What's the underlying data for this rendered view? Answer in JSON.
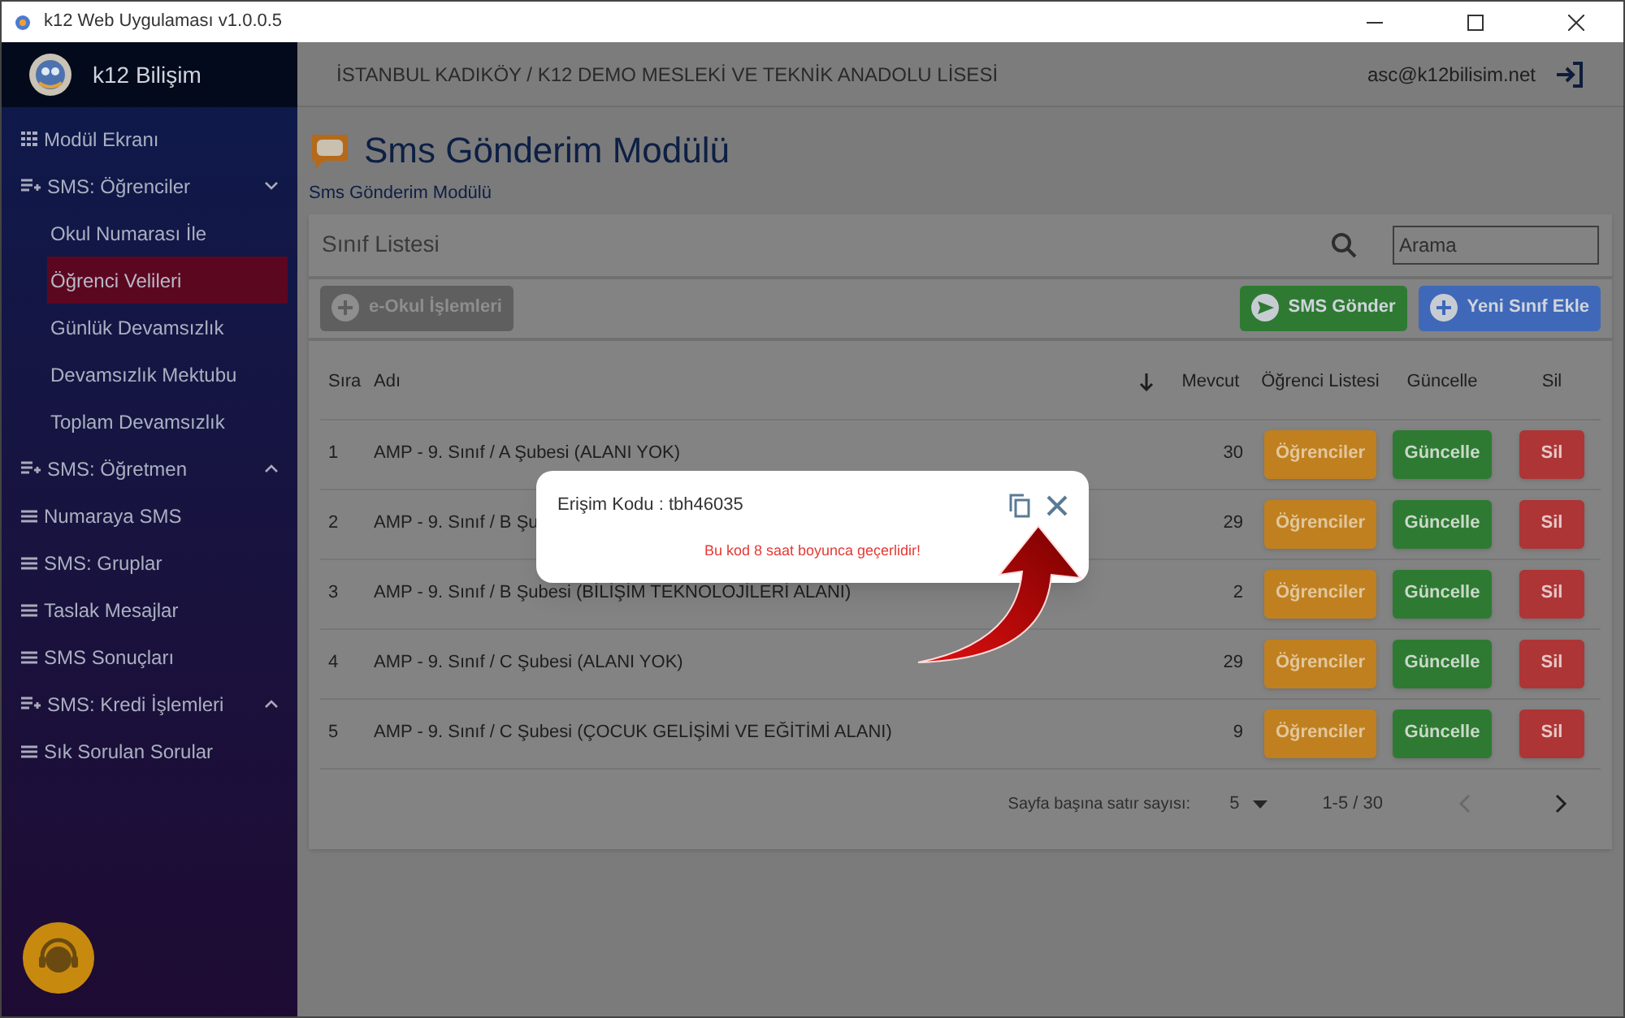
{
  "window": {
    "title": "k12 Web Uygulaması v1.0.0.5"
  },
  "sidebar": {
    "brand": "k12 Bilişim",
    "items": [
      {
        "label": "Modül Ekranı",
        "kind": "module",
        "selected": false
      },
      {
        "label": "SMS: Öğrenciler",
        "kind": "group",
        "expanded": true,
        "selected": false,
        "children": [
          {
            "label": "Okul Numarası İle",
            "selected": false
          },
          {
            "label": "Öğrenci Velileri",
            "selected": true
          },
          {
            "label": "Günlük Devamsızlık",
            "selected": false
          },
          {
            "label": "Devamsızlık Mektubu",
            "selected": false
          },
          {
            "label": "Toplam Devamsızlık",
            "selected": false
          }
        ]
      },
      {
        "label": "SMS: Öğretmen",
        "kind": "group",
        "expanded": false,
        "selected": false
      },
      {
        "label": "Numaraya SMS",
        "kind": "page",
        "selected": false
      },
      {
        "label": "SMS: Gruplar",
        "kind": "page",
        "selected": false
      },
      {
        "label": "Taslak Mesajlar",
        "kind": "page",
        "selected": false
      },
      {
        "label": "SMS Sonuçları",
        "kind": "page",
        "selected": false
      },
      {
        "label": "SMS: Kredi İşlemleri",
        "kind": "group",
        "expanded": false,
        "selected": false
      },
      {
        "label": "Sık Sorulan Sorular",
        "kind": "page",
        "selected": false
      }
    ]
  },
  "topbar": {
    "school": "İSTANBUL KADIKÖY / K12 DEMO MESLEKİ VE TEKNİK ANADOLU LİSESİ",
    "user": "asc@k12bilisim.net"
  },
  "page": {
    "title": "Sms Gönderim Modülü",
    "breadcrumb": "Sms Gönderim Modülü"
  },
  "card": {
    "title": "Sınıf Listesi",
    "search": {
      "placeholder": "Arama"
    },
    "buttons": [
      {
        "label": "e-Okul İşlemleri",
        "kind": "eokul",
        "disabled": true
      },
      {
        "label": "SMS Gönder",
        "kind": "send",
        "disabled": false
      },
      {
        "label": "Yeni Sınıf Ekle",
        "kind": "add",
        "disabled": false
      }
    ]
  },
  "table": {
    "columns": [
      "Sıra",
      "Adı",
      "Mevcut",
      "Öğrenci Listesi",
      "Güncelle",
      "Sil"
    ],
    "rows": [
      {
        "sira": "1",
        "name": "AMP -  9. Sınıf / A Şubesi (ALANI YOK)",
        "count": "30",
        "actions": [
          "Öğrenciler",
          "Güncelle",
          "Sil"
        ]
      },
      {
        "sira": "2",
        "name": "AMP -  9. Sınıf / B Şu",
        "count": "29",
        "actions": [
          "Öğrenciler",
          "Güncelle",
          "Sil"
        ]
      },
      {
        "sira": "3",
        "name": "AMP -  9. Sınıf / B Şubesi (BİLİŞİM TEKNOLOJİLERİ ALANI)",
        "count": "2",
        "actions": [
          "Öğrenciler",
          "Güncelle",
          "Sil"
        ]
      },
      {
        "sira": "4",
        "name": "AMP -  9. Sınıf / C Şubesi (ALANI YOK)",
        "count": "29",
        "actions": [
          "Öğrenciler",
          "Güncelle",
          "Sil"
        ]
      },
      {
        "sira": "5",
        "name": "AMP -  9. Sınıf / C Şubesi (ÇOCUK GELİŞİMİ VE EĞİTİMİ ALANI)",
        "count": "9",
        "actions": [
          "Öğrenciler",
          "Güncelle",
          "Sil"
        ]
      }
    ]
  },
  "pagination": {
    "label": "Sayfa başına satır sayısı:",
    "per_page": "5",
    "range": "1-5 / 30"
  },
  "dialog": {
    "code": "Erişim Kodu : tbh46035",
    "note": "Bu kod 8 saat boyunca geçerlidir!"
  }
}
